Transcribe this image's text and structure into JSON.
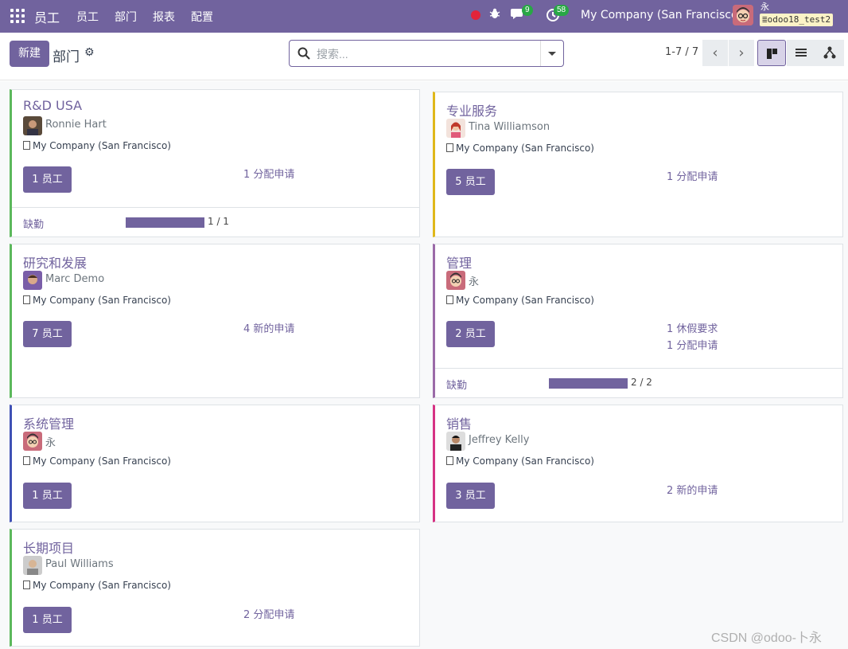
{
  "navbar": {
    "brand": "员工",
    "menu": [
      "员工",
      "部门",
      "报表",
      "配置"
    ],
    "chat_badge": "9",
    "activity_badge": "58",
    "company": "My Company (San Francisco)",
    "user": "永",
    "database": "odoo18_test2"
  },
  "control": {
    "new_label": "新建",
    "breadcrumb": "部门",
    "search_placeholder": "搜索...",
    "pager": "1-7 / 7"
  },
  "departments": [
    {
      "name": "R&D USA",
      "manager": "Ronnie Hart",
      "company": "My Company (San Francisco)",
      "employees": "1 员工",
      "requests": [
        "1 分配申请"
      ],
      "color": "#5cb85c",
      "footer": {
        "label": "缺勤",
        "value": "1 / 1",
        "fraction": 1
      }
    },
    {
      "name": "专业服务",
      "manager": "Tina Williamson",
      "company": "My Company (San Francisco)",
      "employees": "5 员工",
      "requests": [
        "1 分配申请"
      ],
      "color": "#e0b81a"
    },
    {
      "name": "研究和发展",
      "manager": "Marc Demo",
      "company": "My Company (San Francisco)",
      "employees": "7 员工",
      "requests": [
        "4 新的申请"
      ],
      "color": "#5cb85c"
    },
    {
      "name": "管理",
      "manager": "永",
      "company": "My Company (San Francisco)",
      "employees": "2 员工",
      "requests": [
        "1 休假要求",
        "1 分配申请"
      ],
      "color": "#9b6aa8",
      "footer": {
        "label": "缺勤",
        "value": "2 / 2",
        "fraction": 1
      }
    },
    {
      "name": "系统管理",
      "manager": "永",
      "company": "My Company (San Francisco)",
      "employees": "1 员工",
      "requests": [],
      "color": "#3f51b5"
    },
    {
      "name": "销售",
      "manager": "Jeffrey Kelly",
      "company": "My Company (San Francisco)",
      "employees": "3 员工",
      "requests": [
        "2 新的申请"
      ],
      "color": "#d63384"
    },
    {
      "name": "长期项目",
      "manager": "Paul Williams",
      "company": "My Company (San Francisco)",
      "employees": "1 员工",
      "requests": [
        "2 分配申请"
      ],
      "color": "#5cb85c"
    }
  ],
  "watermark": "CSDN @odoo-卜永"
}
